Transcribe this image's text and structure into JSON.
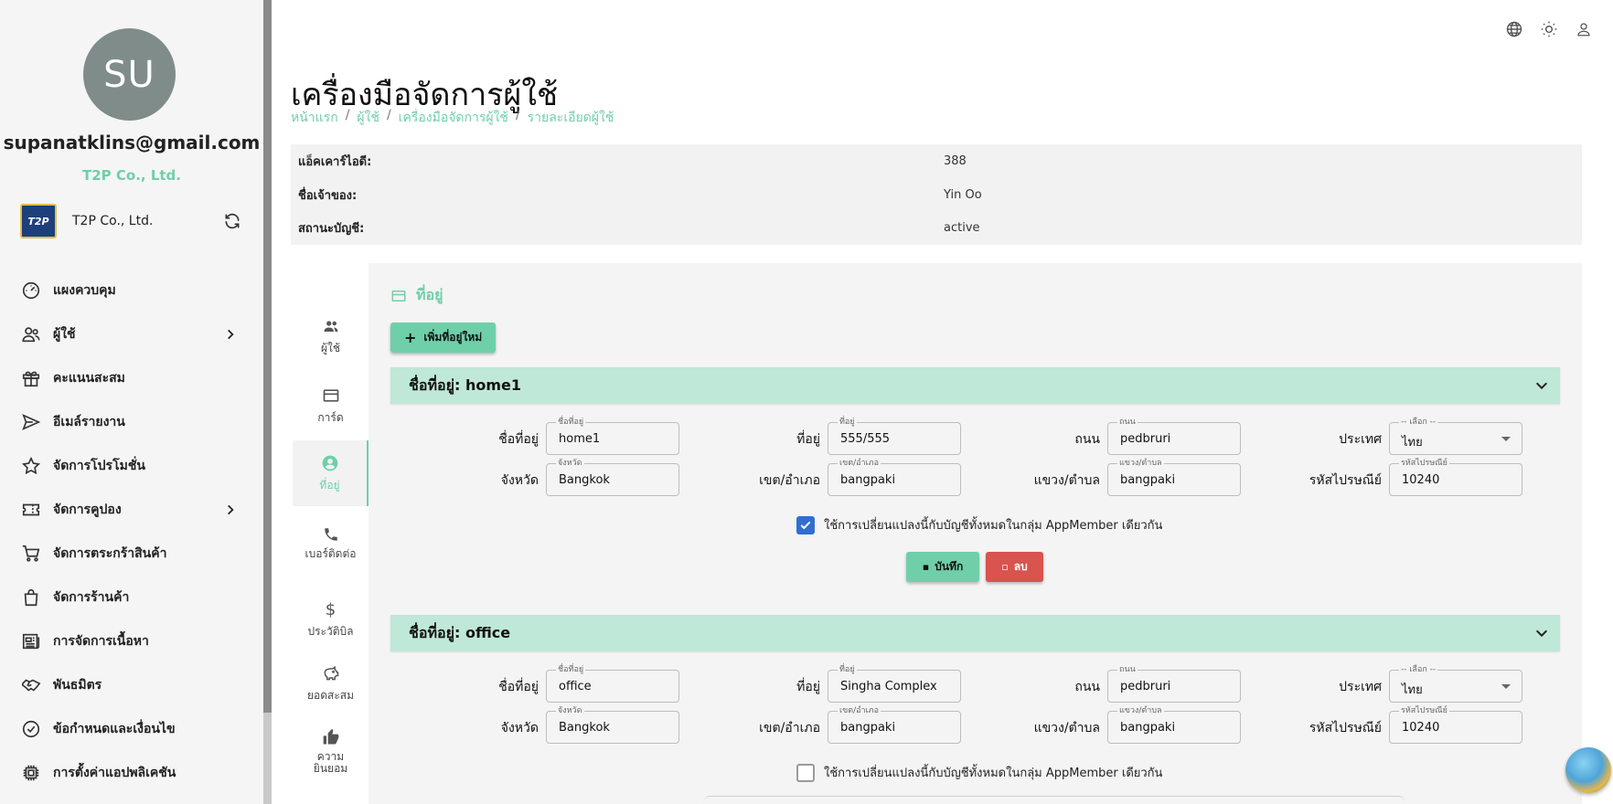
{
  "sidebar": {
    "avatar_initials": "SU",
    "email": "supanatklins@gmail.com",
    "company": "T2P Co., Ltd.",
    "org_logo_text": "T2P",
    "org_name": "T2P Co., Ltd.",
    "items": [
      {
        "label": "แผงควบคุม",
        "icon": "gauge-icon"
      },
      {
        "label": "ผู้ใช้",
        "icon": "users-icon",
        "chevron": true
      },
      {
        "label": "คะแนนสะสม",
        "icon": "gift-icon"
      },
      {
        "label": "อีเมล์รายงาน",
        "icon": "send-icon"
      },
      {
        "label": "จัดการโปรโมชั่น",
        "icon": "star-icon"
      },
      {
        "label": "จัดการคูปอง",
        "icon": "ticket-icon",
        "chevron": true
      },
      {
        "label": "จัดการตระกร้าสินค้า",
        "icon": "cart-icon"
      },
      {
        "label": "จัดการร้านค้า",
        "icon": "bag-icon"
      },
      {
        "label": "การจัดการเนื้อหา",
        "icon": "newspaper-icon"
      },
      {
        "label": "พันธมิตร",
        "icon": "handshake-icon"
      },
      {
        "label": "ข้อกำหนดและเงื่อนไข",
        "icon": "check-circle-icon"
      },
      {
        "label": "การตั้งค่าแอปพลิเคชัน",
        "icon": "chip-icon"
      }
    ]
  },
  "header": {
    "title": "เครื่องมือจัดการผู้ใช้",
    "breadcrumb": [
      "หน้าแรก",
      "ผู้ใช้",
      "เครื่องมือจัดการผู้ใช้",
      "รายละเอียดผู้ใช้"
    ],
    "separator": "/"
  },
  "info": {
    "rows": [
      {
        "label": "แอ็คเคาร์ไอดี:",
        "value": "388"
      },
      {
        "label": "ชื่อเจ้าของ:",
        "value": "Yin Oo"
      },
      {
        "label": "สถานะบัญชี:",
        "value": "active"
      }
    ]
  },
  "tabs": [
    {
      "label": "ผู้ใช้",
      "icon": "users-icon"
    },
    {
      "label": "การ์ด",
      "icon": "card-icon"
    },
    {
      "label": "ที่อยู่",
      "icon": "account-circle-icon",
      "active": true
    },
    {
      "label": "เบอร์ติดต่อ",
      "icon": "phone-icon"
    },
    {
      "label": "ประวัติบิล",
      "icon": "dollar-icon"
    },
    {
      "label": "ยอดสะสม",
      "icon": "piggy-bank-icon"
    },
    {
      "label": "ความยินยอม",
      "icon": "thumb-up-icon"
    }
  ],
  "content": {
    "section_title": "ที่อยู่",
    "add_button": "เพิ่มที่อยู่ใหม่",
    "save_button": "บันทึก",
    "delete_button": "ลบ",
    "checkbox_label": "ใช้การเปลี่ยนแปลงนี้กับบัญชีทั้งหมดในกลุ่ม AppMember เดียวกัน",
    "labels": {
      "name": "ชื่อที่อยู่",
      "address": "ที่อยู่",
      "road": "ถนน",
      "country": "ประเทศ",
      "province": "จังหวัด",
      "district": "เขต/อำเภอ",
      "subdistrict": "แขวง/ตำบล",
      "postcode": "รหัสไปรษณีย์"
    },
    "legends": {
      "name": "ชื่อที่อยู่",
      "address": "ที่อยู่",
      "road": "ถนน",
      "country": "-- เลือก --",
      "province": "จังหวัด",
      "district": "เขต/อำเภอ",
      "subdistrict": "แขวง/ตำบล",
      "postcode": "รหัสไปรษณีย์"
    },
    "addresses": [
      {
        "header": "ชื่อที่อยู่: home1",
        "name": "home1",
        "address": "555/555",
        "road": "pedbruri",
        "country": "ไทย",
        "province": "Bangkok",
        "district": "bangpaki",
        "subdistrict": "bangpaki",
        "postcode": "10240",
        "apply_all": true
      },
      {
        "header": "ชื่อที่อยู่: office",
        "name": "office",
        "address": "Singha Complex",
        "road": "pedbruri",
        "country": "ไทย",
        "province": "Bangkok",
        "district": "bangpaki",
        "subdistrict": "bangpaki",
        "postcode": "10240",
        "apply_all": false
      }
    ]
  },
  "colors": {
    "accent": "#6fcfa9",
    "accordion": "#bfe8d8",
    "danger": "#d9534f",
    "checkbox": "#2f6fd0"
  }
}
